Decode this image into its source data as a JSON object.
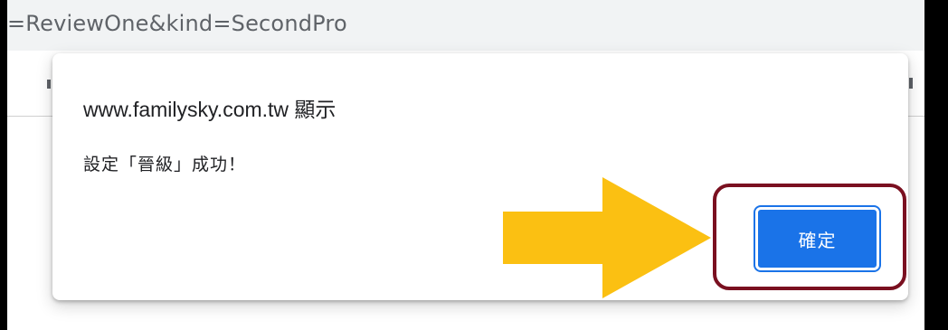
{
  "browser": {
    "url_fragment": "=ReviewOne&kind=SecondPro"
  },
  "dialog": {
    "title": "www.familysky.com.tw 顯示",
    "message": "設定「晉級」成功！",
    "ok_button_label": "確定"
  },
  "colors": {
    "button": "#1a73e8",
    "arrow": "#fbc012",
    "highlight_box": "#7a1020"
  },
  "annotations": {
    "arrow_icon": "arrow-right-icon"
  }
}
